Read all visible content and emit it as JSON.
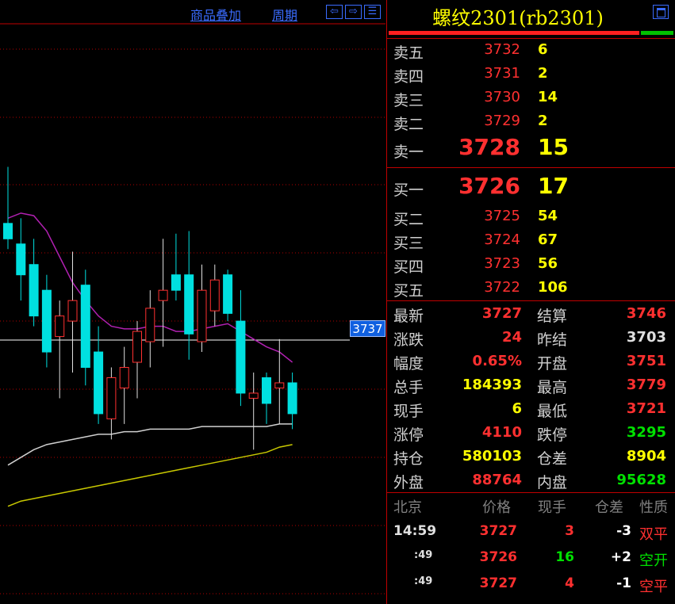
{
  "toolbar": {
    "overlay_label": "商品叠加",
    "period_label": "周期",
    "btn_left": "⇦",
    "btn_right": "⇨",
    "btn_layout": "☰"
  },
  "chart": {
    "current_price_tag": "3737"
  },
  "quote": {
    "title": "螺纹2301(rb2301)",
    "ratio_sell_fraction": 0.88,
    "asks": [
      {
        "label": "卖五",
        "price": "3732",
        "volume": "6"
      },
      {
        "label": "卖四",
        "price": "3731",
        "volume": "2"
      },
      {
        "label": "卖三",
        "price": "3730",
        "volume": "14"
      },
      {
        "label": "卖二",
        "price": "3729",
        "volume": "2"
      },
      {
        "label": "卖一",
        "price": "3728",
        "volume": "15"
      }
    ],
    "bids": [
      {
        "label": "买一",
        "price": "3726",
        "volume": "17"
      },
      {
        "label": "买二",
        "price": "3725",
        "volume": "54"
      },
      {
        "label": "买三",
        "price": "3724",
        "volume": "67"
      },
      {
        "label": "买四",
        "price": "3723",
        "volume": "56"
      },
      {
        "label": "买五",
        "price": "3722",
        "volume": "106"
      }
    ],
    "stats": [
      {
        "l": "最新",
        "lv": "3727",
        "lc": "#ff3030",
        "r": "结算",
        "rv": "3746",
        "rc": "#ff3030"
      },
      {
        "l": "涨跌",
        "lv": "24",
        "lc": "#ff3030",
        "r": "昨结",
        "rv": "3703",
        "rc": "#e0e0e0"
      },
      {
        "l": "幅度",
        "lv": "0.65%",
        "lc": "#ff3030",
        "r": "开盘",
        "rv": "3751",
        "rc": "#ff3030"
      },
      {
        "l": "总手",
        "lv": "184393",
        "lc": "#ffff00",
        "r": "最高",
        "rv": "3779",
        "rc": "#ff3030"
      },
      {
        "l": "现手",
        "lv": "6",
        "lc": "#ffff00",
        "r": "最低",
        "rv": "3721",
        "rc": "#ff3030"
      },
      {
        "l": "涨停",
        "lv": "4110",
        "lc": "#ff3030",
        "r": "跌停",
        "rv": "3295",
        "rc": "#00e000"
      },
      {
        "l": "持仓",
        "lv": "580103",
        "lc": "#ffff00",
        "r": "仓差",
        "rv": "8904",
        "rc": "#ffff00"
      },
      {
        "l": "外盘",
        "lv": "88764",
        "lc": "#ff3030",
        "r": "内盘",
        "rv": "95628",
        "rc": "#00e000"
      }
    ],
    "tick_headers": [
      "北京",
      "价格",
      "现手",
      "仓差",
      "性质"
    ],
    "ticks": [
      {
        "time": "14:59",
        "price": "3727",
        "vol": "3",
        "oi": "-3",
        "nature": "双平",
        "nc": "#ff3030",
        "vc": "#ff3030"
      },
      {
        "time": ":49",
        "price": "3726",
        "vol": "16",
        "oi": "+2",
        "nature": "空开",
        "nc": "#00e000",
        "vc": "#00e000"
      },
      {
        "time": ":49",
        "price": "3727",
        "vol": "4",
        "oi": "-1",
        "nature": "空平",
        "nc": "#ff3030",
        "vc": "#ff3030"
      }
    ]
  },
  "chart_data": {
    "type": "candlestick",
    "candles": [
      {
        "o": 3768,
        "h": 3790,
        "l": 3758,
        "c": 3762,
        "up": false
      },
      {
        "o": 3760,
        "h": 3770,
        "l": 3738,
        "c": 3748,
        "up": false
      },
      {
        "o": 3752,
        "h": 3762,
        "l": 3728,
        "c": 3732,
        "up": false
      },
      {
        "o": 3742,
        "h": 3748,
        "l": 3712,
        "c": 3718,
        "up": false
      },
      {
        "o": 3724,
        "h": 3738,
        "l": 3700,
        "c": 3732,
        "up": true
      },
      {
        "o": 3730,
        "h": 3757,
        "l": 3710,
        "c": 3738,
        "up": true
      },
      {
        "o": 3744,
        "h": 3750,
        "l": 3705,
        "c": 3712,
        "up": false
      },
      {
        "o": 3718,
        "h": 3728,
        "l": 3690,
        "c": 3694,
        "up": false
      },
      {
        "o": 3692,
        "h": 3712,
        "l": 3684,
        "c": 3708,
        "up": true
      },
      {
        "o": 3704,
        "h": 3720,
        "l": 3690,
        "c": 3712,
        "up": true
      },
      {
        "o": 3714,
        "h": 3730,
        "l": 3700,
        "c": 3726,
        "up": true
      },
      {
        "o": 3722,
        "h": 3742,
        "l": 3712,
        "c": 3735,
        "up": true
      },
      {
        "o": 3738,
        "h": 3762,
        "l": 3720,
        "c": 3742,
        "up": true
      },
      {
        "o": 3748,
        "h": 3764,
        "l": 3738,
        "c": 3742,
        "up": false
      },
      {
        "o": 3748,
        "h": 3765,
        "l": 3715,
        "c": 3725,
        "up": false
      },
      {
        "o": 3742,
        "h": 3752,
        "l": 3718,
        "c": 3722,
        "up": true
      },
      {
        "o": 3746,
        "h": 3752,
        "l": 3728,
        "c": 3734,
        "up": true
      },
      {
        "o": 3748,
        "h": 3750,
        "l": 3730,
        "c": 3733,
        "up": false
      },
      {
        "o": 3730,
        "h": 3742,
        "l": 3697,
        "c": 3702,
        "up": false
      },
      {
        "o": 3702,
        "h": 3710,
        "l": 3680,
        "c": 3700,
        "up": true
      },
      {
        "o": 3708,
        "h": 3710,
        "l": 3690,
        "c": 3698,
        "up": false
      },
      {
        "o": 3706,
        "h": 3723,
        "l": 3690,
        "c": 3704,
        "up": true
      },
      {
        "o": 3706,
        "h": 3710,
        "l": 3688,
        "c": 3694,
        "up": false
      }
    ],
    "ma_fast": [
      3770,
      3772,
      3771,
      3765,
      3755,
      3745,
      3738,
      3732,
      3728,
      3727,
      3727,
      3728,
      3728,
      3726,
      3726,
      3727,
      3728,
      3729,
      3726,
      3723,
      3720,
      3718,
      3714
    ],
    "ma_slow1": [
      3674,
      3677,
      3680,
      3682,
      3683,
      3684,
      3685,
      3686,
      3686,
      3687,
      3687,
      3688,
      3688,
      3688,
      3688,
      3689,
      3689,
      3689,
      3689,
      3689,
      3689,
      3690,
      3690
    ],
    "ma_slow2": [
      3658,
      3660,
      3661,
      3662,
      3663,
      3664,
      3665,
      3666,
      3667,
      3668,
      3669,
      3670,
      3671,
      3672,
      3673,
      3674,
      3675,
      3676,
      3677,
      3678,
      3679,
      3681,
      3682
    ],
    "current_line": 3737,
    "y_range": [
      3620,
      3845
    ],
    "grid": true
  }
}
